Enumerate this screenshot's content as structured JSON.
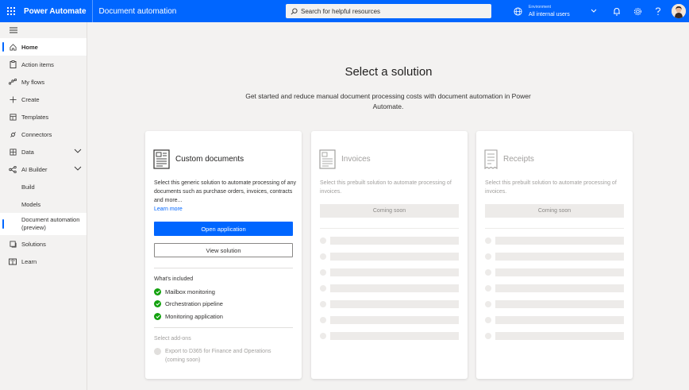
{
  "header": {
    "app_name": "Power Automate",
    "page_name": "Document automation",
    "search_placeholder": "Search for helpful resources",
    "environment_label": "Environment",
    "environment_value": "All internal users",
    "brand_color": "#0066ff"
  },
  "sidebar": {
    "items": [
      {
        "label": "Home",
        "icon": "home-icon"
      },
      {
        "label": "Action items",
        "icon": "clipboard-icon"
      },
      {
        "label": "My flows",
        "icon": "flow-icon"
      },
      {
        "label": "Create",
        "icon": "plus-icon"
      },
      {
        "label": "Templates",
        "icon": "templates-icon"
      },
      {
        "label": "Connectors",
        "icon": "connector-icon"
      },
      {
        "label": "Data",
        "icon": "data-icon"
      },
      {
        "label": "AI Builder",
        "icon": "ai-builder-icon"
      },
      {
        "label": "Build"
      },
      {
        "label": "Models"
      },
      {
        "label": "Document automation",
        "label2": "(preview)"
      },
      {
        "label": "Solutions",
        "icon": "solutions-icon"
      },
      {
        "label": "Learn",
        "icon": "book-icon"
      }
    ]
  },
  "main": {
    "title": "Select a solution",
    "subtitle": "Get started and reduce manual document processing costs with document automation in Power Automate.",
    "cards": {
      "custom": {
        "title": "Custom documents",
        "description": "Select this generic solution to automate processing of any documents such as purchase orders, invoices, contracts and more...",
        "learn_more": "Learn more",
        "primary_button": "Open application",
        "secondary_button": "View solution",
        "included_label": "What's included",
        "included": [
          "Mailbox monitoring",
          "Orchestration pipeline",
          "Monitoring application"
        ],
        "addons_label": "Select add-ons",
        "addon": "Export to D365 for Finance and Operations (coming soon)"
      },
      "invoices": {
        "title": "Invoices",
        "description": "Select this prebuilt solution to automate processing of invoices.",
        "status": "Coming soon"
      },
      "receipts": {
        "title": "Receipts",
        "description": "Select this prebuilt solution to automate processing of invoices.",
        "status": "Coming soon"
      }
    }
  }
}
